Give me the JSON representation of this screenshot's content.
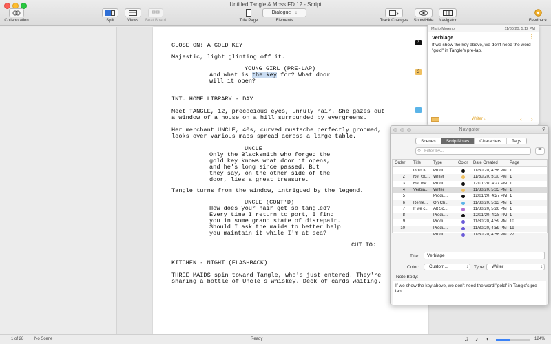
{
  "window": {
    "title": "Untitled Tangle & Moss FD 12 - Script"
  },
  "toolbar": {
    "collaboration": "Collaboration",
    "split": "Split",
    "views": "Views",
    "beat_board": "Beat Board",
    "title_page": "Title Page",
    "elements": "Elements",
    "elements_value": "Dialogue",
    "track_changes": "Track Changes",
    "show_hide": "Show/Hide",
    "navigator": "Navigator",
    "feedback": "Feedback"
  },
  "script": {
    "lines": [
      {
        "text": "CLOSE ON: A GOLD KEY",
        "style": "action"
      },
      {
        "text": "Majestic, light glinting off it.",
        "style": "action"
      },
      {
        "text": "YOUNG GIRL (PRE-LAP)",
        "style": "character"
      },
      {
        "text_pre": "And what is ",
        "text_hl": "the key",
        "text_post": " for? What door",
        "style": "dialogue-italic"
      },
      {
        "text": "will it open?",
        "style": "dialogue-italic"
      },
      {
        "text": "INT. HOME LIBRARY - DAY",
        "style": "scene"
      },
      {
        "text": "Meet TANGLE, 12, precocious eyes, unruly hair. She gazes out",
        "style": "action"
      },
      {
        "text": "a window of a house on a hill surrounded by evergreens.",
        "style": "action"
      },
      {
        "text": "Her merchant UNCLE, 40s, curved mustache perfectly groomed,",
        "style": "action"
      },
      {
        "text": "looks over various maps spread across a large table.",
        "style": "action"
      },
      {
        "text": "UNCLE",
        "style": "character"
      },
      {
        "text": "Only the Blacksmith who forged the",
        "style": "dialogue"
      },
      {
        "text": "gold key knows what door it opens,",
        "style": "dialogue"
      },
      {
        "text": "and he's long since passed. But",
        "style": "dialogue"
      },
      {
        "text": "they say, on the other side of the",
        "style": "dialogue"
      },
      {
        "text": "door, lies a great treasure.",
        "style": "dialogue"
      },
      {
        "text": "Tangle turns from the window, intrigued by the legend.",
        "style": "action"
      },
      {
        "text": "UNCLE (CONT'D)",
        "style": "character"
      },
      {
        "text": "How does your hair get so tangled?",
        "style": "dialogue"
      },
      {
        "text": "Every time I return to port, I find",
        "style": "dialogue"
      },
      {
        "text": "you in some grand state of disrepair.",
        "style": "dialogue"
      },
      {
        "text": "Should I ask the maids to better help",
        "style": "dialogue"
      },
      {
        "text": "you maintain it while I'm at sea?",
        "style": "dialogue"
      },
      {
        "text": "CUT TO:",
        "style": "transition"
      },
      {
        "text": "KITCHEN - NIGHT (FLASHBACK)",
        "style": "scene-italic"
      },
      {
        "text": "THREE MAIDS spin toward Tangle, who's just entered. They're",
        "style": "action-italic"
      },
      {
        "text": "sharing a bottle of Uncle's whiskey. Deck of cards waiting.",
        "style": "action-italic"
      }
    ],
    "markers": [
      {
        "label": "3",
        "color": "#111111",
        "text_color": "#ffffff"
      },
      {
        "label": "2",
        "color": "#f0c060",
        "text_color": "#333333"
      },
      {
        "label": "",
        "color": "#5bb4e8",
        "text_color": "#ffffff"
      }
    ]
  },
  "note_popover": {
    "author": "Mario Moreno",
    "timestamp": "11/30/20, 5:12 PM",
    "title": "Verbiage",
    "body": "If we show the key above, we don't need the word \"gold\" in Tangle's pre-lap.",
    "type_value": "Writer",
    "accent_color": "#f0c060"
  },
  "navigator": {
    "title": "Navigator",
    "tabs": [
      "Scenes",
      "ScriptNotes",
      "Characters",
      "Tags"
    ],
    "active_tab": "ScriptNotes",
    "filter_placeholder": "Filter by...",
    "columns": [
      "Order",
      "Title",
      "Type",
      "Color",
      "Date Created",
      "Page"
    ],
    "rows": [
      {
        "order": "1",
        "title": "Gold K...",
        "type": "Produ...",
        "color": "#111111",
        "date": "11/30/20, 4:58 PM",
        "page": "1"
      },
      {
        "order": "2",
        "title": "Re: Go...",
        "type": "Writer",
        "color": "#f0c060",
        "date": "11/30/20, 5:00 PM",
        "page": "1"
      },
      {
        "order": "3",
        "title": "Re: Re:...",
        "type": "Produ...",
        "color": "#111111",
        "date": "12/01/20, 4:27 PM",
        "page": "1"
      },
      {
        "order": "4",
        "title": "Verbia...",
        "type": "Writer",
        "color": "#f0c060",
        "date": "11/30/20, 5:05 PM",
        "page": "1"
      },
      {
        "order": "5",
        "title": "",
        "type": "Produ...",
        "color": "#111111",
        "date": "12/01/20, 4:27 PM",
        "page": "1"
      },
      {
        "order": "6",
        "title": "Reme...",
        "type": "On Ch...",
        "color": "#5bb4e8",
        "date": "11/30/20, 5:13 PM",
        "page": "1"
      },
      {
        "order": "7",
        "title": "If we c...",
        "type": "Alt Sc...",
        "color": "#b070d0",
        "date": "11/30/20, 5:26 PM",
        "page": "1"
      },
      {
        "order": "8",
        "title": "",
        "type": "Produ...",
        "color": "#111111",
        "date": "12/01/20, 4:28 PM",
        "page": "1"
      },
      {
        "order": "9",
        "title": "",
        "type": "Produ...",
        "color": "#6b5bd8",
        "date": "11/30/20, 4:59 PM",
        "page": "10"
      },
      {
        "order": "10",
        "title": "",
        "type": "Produ...",
        "color": "#6b5bd8",
        "date": "11/30/20, 4:59 PM",
        "page": "19"
      },
      {
        "order": "11",
        "title": "",
        "type": "Produ...",
        "color": "#6b5bd8",
        "date": "11/30/20, 4:58 PM",
        "page": "22"
      }
    ],
    "selected_row": 3,
    "form": {
      "title_label": "Title:",
      "title_value": "Verbiage",
      "color_label": "Color:",
      "color_value": "Custom...",
      "type_label": "Type:",
      "type_value": "Writer",
      "note_body_label": "Note Body:",
      "note_body_value": "If we show the key above, we don't need the word \"gold\" in Tangle's pre-lap."
    }
  },
  "statusbar": {
    "page": "1 of 28",
    "scene": "No Scene",
    "status": "Ready",
    "zoom": "124%"
  }
}
